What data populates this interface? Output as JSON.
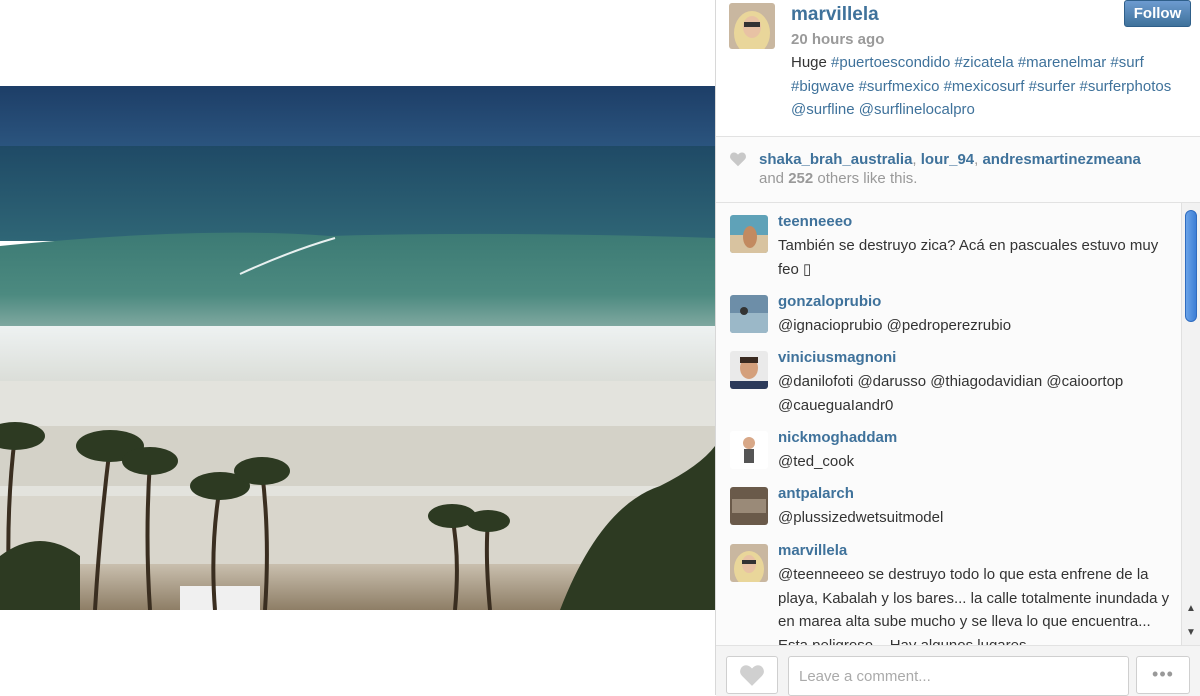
{
  "post": {
    "username": "marvillela",
    "time": "20 hours ago",
    "follow_label": "Follow",
    "caption_prefix": "Huge ",
    "caption_tags": [
      "#puertoescondido",
      "#zicatela",
      "#marenelmar",
      "#surf",
      "#bigwave",
      "#surfmexico",
      "#mexicosurf",
      "#surfer",
      "#surferphotos",
      "@surfline",
      "@surflinelocalpro"
    ]
  },
  "likes": {
    "likers": [
      "shaka_brah_australia",
      "lour_94",
      "andresmartinezmeana"
    ],
    "and_text": "and",
    "count": "252",
    "suffix": "others like this."
  },
  "comments": [
    {
      "user": "teenneeeo",
      "text": "También se destruyo zica? Acá en pascuales estuvo muy feo ▯"
    },
    {
      "user": "gonzaloprubio",
      "text": "@ignacioprubio @pedroperezrubio"
    },
    {
      "user": "viniciusmagnoni",
      "text": "@danilofoti @darusso @thiagodavidian @caioortop @caueguaIandr0"
    },
    {
      "user": "nickmoghaddam",
      "text": "@ted_cook"
    },
    {
      "user": "antpalarch",
      "text": "@plussizedwetsuitmodel"
    },
    {
      "user": "marvillela",
      "text": "@teenneeeo se destruyo todo lo que esta enfrene de la playa, Kabalah y los bares... la calle totalmente inundada y en marea alta sube mucho y se lleva lo que encuentra... Esta peligroso... Hay algunos lugares"
    }
  ],
  "comment_box": {
    "placeholder": "Leave a comment..."
  },
  "more_label": "•••",
  "icons": {
    "like": "heart-icon",
    "more": "more-icon",
    "scroll_up": "chevron-up-icon",
    "scroll_down": "chevron-down-icon"
  },
  "colors": {
    "link": "#3f729b",
    "follow_button": "#4f80b8"
  }
}
